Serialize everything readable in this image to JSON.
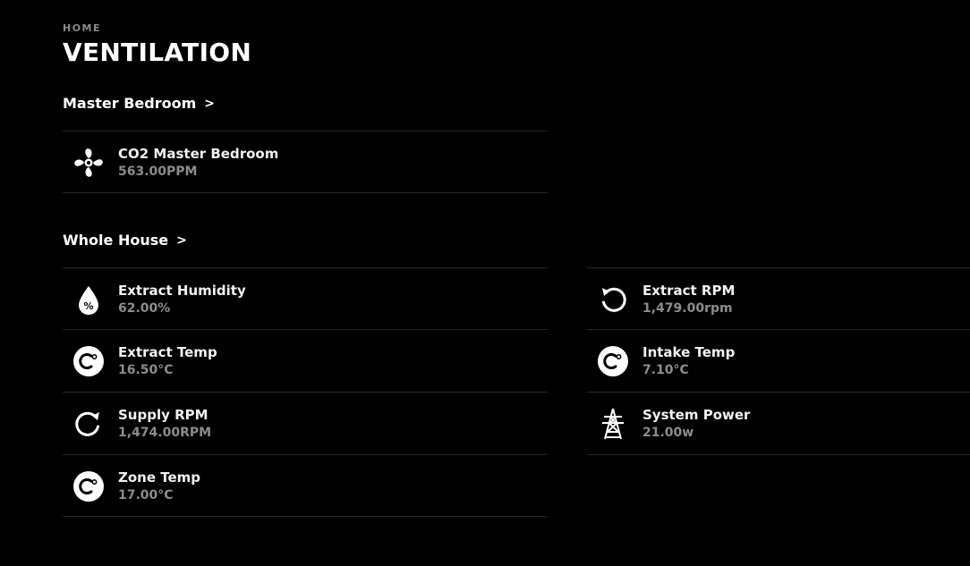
{
  "header": {
    "breadcrumb": "HOME",
    "title": "VENTILATION"
  },
  "sections": [
    {
      "label": "Master Bedroom",
      "chevron": ">",
      "items": [
        {
          "name": "CO2 Master Bedroom",
          "value": "563.00PPM",
          "icon": "fan-icon"
        }
      ]
    },
    {
      "label": "Whole House",
      "chevron": ">",
      "items": [
        {
          "name": "Extract Humidity",
          "value": "62.00%",
          "icon": "humidity-drop-icon"
        },
        {
          "name": "Extract RPM",
          "value": "1,479.00rpm",
          "icon": "rotate-ccw-icon"
        },
        {
          "name": "Extract Temp",
          "value": "16.50°C",
          "icon": "celsius-icon"
        },
        {
          "name": "Intake Temp",
          "value": "7.10°C",
          "icon": "celsius-icon"
        },
        {
          "name": "Supply RPM",
          "value": "1,474.00RPM",
          "icon": "rotate-cw-icon"
        },
        {
          "name": "System Power",
          "value": "21.00w",
          "icon": "power-tower-icon"
        },
        {
          "name": "Zone Temp",
          "value": "17.00°C",
          "icon": "celsius-icon"
        }
      ]
    }
  ],
  "colors": {
    "background": "#000000",
    "text": "#ffffff",
    "secondary_text": "#8c8c8c",
    "divider": "#262626"
  }
}
